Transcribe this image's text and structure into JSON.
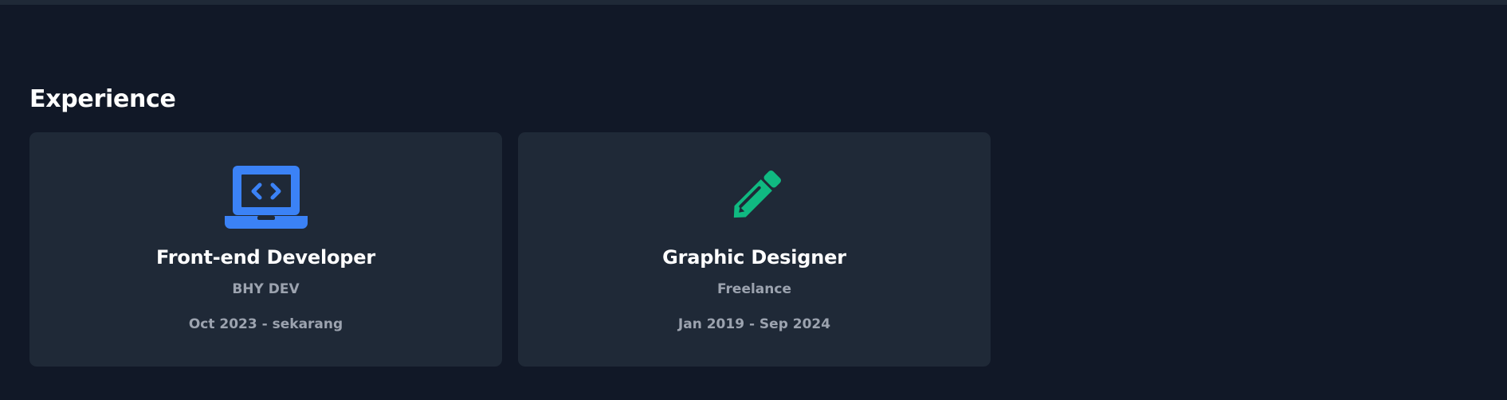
{
  "colors": {
    "background": "#111827",
    "card_background": "#1f2937",
    "title_text": "#ffffff",
    "muted_text": "#9ca3af",
    "developer_icon": "#3b82f6",
    "designer_icon": "#10b981"
  },
  "section": {
    "title": "Experience"
  },
  "experiences": [
    {
      "icon": "laptop-code-icon",
      "role": "Front-end Developer",
      "company": "BHY DEV",
      "period": "Oct 2023 - sekarang"
    },
    {
      "icon": "pencil-icon",
      "role": "Graphic Designer",
      "company": "Freelance",
      "period": "Jan 2019 - Sep 2024"
    }
  ]
}
